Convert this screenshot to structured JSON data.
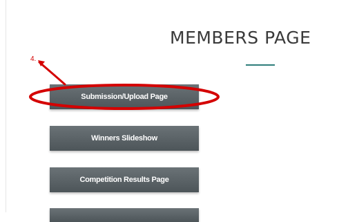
{
  "header": {
    "title": "MEMBERS PAGE"
  },
  "annotation": {
    "step_number": "4.",
    "color": "#d40000"
  },
  "buttons": [
    {
      "label": "Submission/Upload Page"
    },
    {
      "label": "Winners Slideshow"
    },
    {
      "label": "Competition Results Page"
    },
    {
      "label": ""
    }
  ],
  "colors": {
    "button_background": "#5a6266",
    "accent_underline": "#2e7d7a",
    "title_text": "#3a3a3a"
  }
}
